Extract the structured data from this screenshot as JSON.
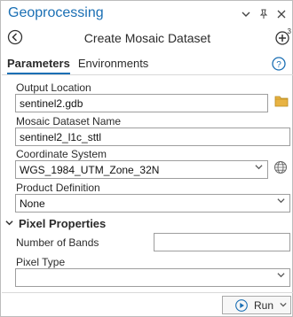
{
  "window": {
    "title": "Geoprocessing",
    "icons": [
      "chevron-down-icon",
      "pin-icon",
      "close-icon"
    ]
  },
  "tool": {
    "title": "Create Mosaic Dataset",
    "add_badge": "3"
  },
  "tabs": [
    {
      "label": "Parameters",
      "active": true
    },
    {
      "label": "Environments",
      "active": false
    }
  ],
  "params": {
    "output_location": {
      "label": "Output Location",
      "value": "sentinel2.gdb"
    },
    "mosaic_name": {
      "label": "Mosaic Dataset Name",
      "value": "sentinel2_l1c_sttl"
    },
    "coordinate_system": {
      "label": "Coordinate System",
      "value": "WGS_1984_UTM_Zone_32N"
    },
    "product_definition": {
      "label": "Product Definition",
      "value": "None"
    }
  },
  "pixel_properties": {
    "title": "Pixel Properties",
    "number_of_bands": {
      "label": "Number of Bands",
      "value": ""
    },
    "pixel_type": {
      "label": "Pixel Type",
      "value": ""
    }
  },
  "run_button": {
    "label": "Run"
  },
  "colors": {
    "accent": "#1a6fb4",
    "folder": "#e8b343"
  }
}
